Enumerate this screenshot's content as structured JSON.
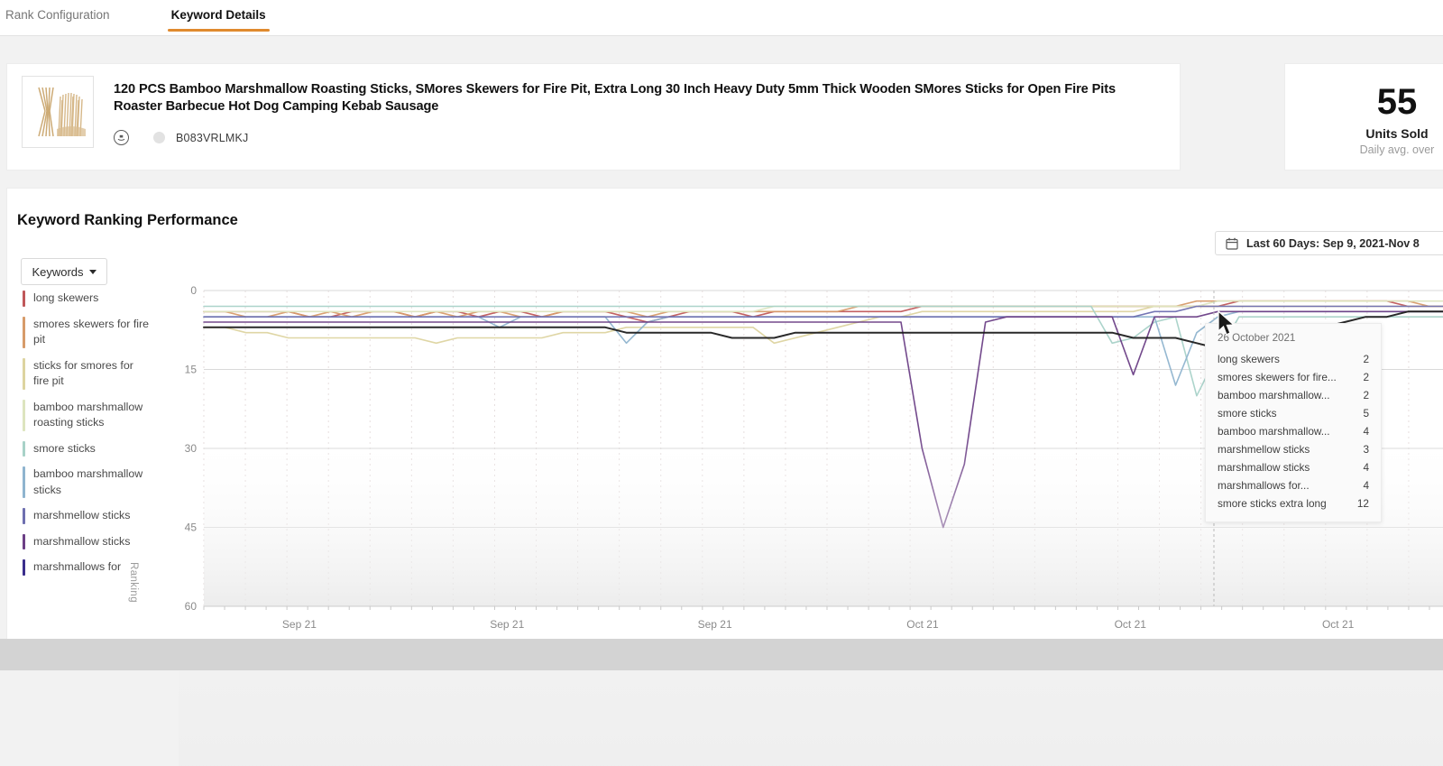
{
  "tabs": [
    {
      "label": "Rank Configuration",
      "active": false
    },
    {
      "label": "Keyword Details",
      "active": true
    }
  ],
  "product": {
    "title": "120 PCS Bamboo Marshmallow Roasting Sticks, SMores Skewers for Fire Pit, Extra Long 30 Inch Heavy Duty 5mm Thick Wooden SMores Sticks for Open Fire Pits Roaster Barbecue Hot Dog Camping Kebab Sausage",
    "asin": "B083VRLMKJ",
    "marketplace_icon": "amazon-badge-icon",
    "thumbnail_icon": "bamboo-skewers-thumbnail"
  },
  "stat_card": {
    "value": "55",
    "label": "Units Sold",
    "sublabel": "Daily avg. over"
  },
  "chart_panel": {
    "title": "Keyword Ranking Performance",
    "date_range": "Last 60 Days: Sep 9, 2021-Nov 8",
    "calendar_icon": "calendar-icon",
    "keywords_button": "Keywords",
    "axis_label_y": "Ranking"
  },
  "legend": [
    {
      "label": "long skewers",
      "color": "#c0585a"
    },
    {
      "label": "smores skewers for fire pit",
      "color": "#d79b6a"
    },
    {
      "label": "sticks for smores for fire pit",
      "color": "#ddd4a0"
    },
    {
      "label": "bamboo marshmallow roasting sticks",
      "color": "#dde5bf"
    },
    {
      "label": "smore sticks",
      "color": "#a8d2c8"
    },
    {
      "label": "bamboo marshmallow sticks",
      "color": "#8fb4cf"
    },
    {
      "label": "marshmellow sticks",
      "color": "#6e6fb0"
    },
    {
      "label": "marshmallow sticks",
      "color": "#6c3f86"
    },
    {
      "label": "marshmallows for",
      "color": "#3a2e8c"
    }
  ],
  "tooltip": {
    "date": "26 October 2021",
    "rows": [
      {
        "name": "long skewers",
        "value": "2"
      },
      {
        "name": "smores skewers for fire...",
        "value": "2"
      },
      {
        "name": "bamboo marshmallow...",
        "value": "2"
      },
      {
        "name": "smore sticks",
        "value": "5"
      },
      {
        "name": "bamboo marshmallow...",
        "value": "4"
      },
      {
        "name": "marshmellow sticks",
        "value": "3"
      },
      {
        "name": "marshmallow sticks",
        "value": "4"
      },
      {
        "name": "marshmallows for...",
        "value": "4"
      },
      {
        "name": "smore sticks extra long",
        "value": "12"
      }
    ]
  },
  "chart_data": {
    "type": "line",
    "title": "Keyword Ranking Performance",
    "xlabel": "",
    "ylabel": "Ranking",
    "ylim": [
      0,
      60
    ],
    "y_inverted": true,
    "yticks": [
      0,
      15,
      30,
      45,
      60
    ],
    "xticks": [
      "Sep 21",
      "Sep 21",
      "Sep 21",
      "Oct 21",
      "Oct 21",
      "Oct 21"
    ],
    "grid": true,
    "legend_position": "left",
    "x": [
      0,
      1,
      2,
      3,
      4,
      5,
      6,
      7,
      8,
      9,
      10,
      11,
      12,
      13,
      14,
      15,
      16,
      17,
      18,
      19,
      20,
      21,
      22,
      23,
      24,
      25,
      26,
      27,
      28,
      29,
      30,
      31,
      32,
      33,
      34,
      35,
      36,
      37,
      38,
      39,
      40,
      41,
      42,
      43,
      44,
      45,
      46,
      47,
      48,
      49,
      50,
      51,
      52,
      53,
      54,
      55,
      56,
      57,
      58,
      59
    ],
    "series": [
      {
        "name": "long skewers",
        "color": "#c0585a",
        "values": [
          4,
          4,
          4,
          4,
          4,
          5,
          5,
          4,
          4,
          4,
          5,
          4,
          4,
          5,
          4,
          4,
          5,
          4,
          4,
          4,
          5,
          6,
          5,
          4,
          4,
          4,
          5,
          4,
          4,
          4,
          4,
          4,
          4,
          4,
          3,
          3,
          3,
          3,
          3,
          3,
          3,
          3,
          3,
          3,
          3,
          3,
          3,
          3,
          3,
          2,
          2,
          2,
          2,
          2,
          2,
          2,
          2,
          3,
          3,
          3
        ]
      },
      {
        "name": "smores skewers for fire pit",
        "color": "#d79b6a",
        "values": [
          4,
          4,
          5,
          5,
          4,
          5,
          4,
          5,
          4,
          4,
          5,
          4,
          5,
          4,
          4,
          5,
          5,
          4,
          4,
          4,
          4,
          5,
          4,
          4,
          4,
          4,
          4,
          4,
          4,
          4,
          4,
          3,
          3,
          3,
          3,
          3,
          3,
          3,
          3,
          3,
          3,
          3,
          3,
          3,
          3,
          3,
          3,
          2,
          2,
          2,
          2,
          2,
          2,
          2,
          2,
          2,
          2,
          2,
          3,
          3
        ]
      },
      {
        "name": "sticks for smores for fire pit",
        "color": "#ddd4a0",
        "values": [
          7,
          7,
          8,
          8,
          9,
          9,
          9,
          9,
          9,
          9,
          9,
          10,
          9,
          9,
          9,
          9,
          9,
          8,
          8,
          8,
          7,
          7,
          7,
          7,
          7,
          7,
          7,
          10,
          9,
          8,
          7,
          6,
          5,
          5,
          4,
          4,
          4,
          4,
          4,
          4,
          4,
          4,
          4,
          4,
          4,
          3,
          3,
          3,
          3,
          3,
          3,
          3,
          3,
          3,
          3,
          3,
          3,
          3,
          3,
          3
        ]
      },
      {
        "name": "bamboo marshmallow roasting sticks",
        "color": "#dde5bf",
        "values": [
          4,
          4,
          4,
          4,
          4,
          4,
          4,
          4,
          4,
          4,
          4,
          4,
          4,
          4,
          4,
          4,
          4,
          4,
          4,
          4,
          4,
          4,
          4,
          4,
          4,
          4,
          4,
          3,
          3,
          3,
          3,
          3,
          3,
          3,
          3,
          3,
          3,
          3,
          3,
          3,
          3,
          3,
          3,
          3,
          3,
          3,
          3,
          3,
          2,
          2,
          2,
          2,
          2,
          2,
          2,
          2,
          2,
          2,
          2,
          2
        ]
      },
      {
        "name": "smore sticks",
        "color": "#a8d2c8",
        "values": [
          3,
          3,
          3,
          3,
          3,
          3,
          3,
          3,
          3,
          3,
          3,
          3,
          3,
          3,
          3,
          3,
          3,
          3,
          3,
          3,
          3,
          3,
          3,
          3,
          3,
          3,
          3,
          3,
          3,
          3,
          3,
          3,
          3,
          3,
          3,
          3,
          3,
          3,
          3,
          3,
          3,
          3,
          3,
          10,
          9,
          6,
          5,
          20,
          12,
          5,
          5,
          5,
          5,
          5,
          5,
          5,
          5,
          5,
          5,
          5
        ]
      },
      {
        "name": "bamboo marshmallow sticks",
        "color": "#8fb4cf",
        "values": [
          5,
          5,
          5,
          5,
          5,
          5,
          5,
          5,
          5,
          5,
          5,
          5,
          5,
          5,
          7,
          5,
          5,
          5,
          5,
          5,
          10,
          6,
          5,
          5,
          5,
          5,
          5,
          5,
          5,
          5,
          5,
          5,
          5,
          5,
          5,
          5,
          5,
          5,
          5,
          5,
          5,
          5,
          5,
          5,
          5,
          5,
          18,
          8,
          5,
          4,
          4,
          4,
          4,
          4,
          4,
          4,
          4,
          4,
          4,
          4
        ]
      },
      {
        "name": "marshmellow sticks",
        "color": "#6e6fb0",
        "values": [
          5,
          5,
          5,
          5,
          5,
          5,
          5,
          5,
          5,
          5,
          5,
          5,
          5,
          5,
          5,
          5,
          5,
          5,
          5,
          5,
          5,
          5,
          5,
          5,
          5,
          5,
          5,
          5,
          5,
          5,
          5,
          5,
          5,
          5,
          5,
          5,
          5,
          5,
          5,
          5,
          5,
          5,
          5,
          5,
          5,
          4,
          4,
          3,
          3,
          3,
          3,
          3,
          3,
          3,
          3,
          3,
          3,
          3,
          3,
          3
        ]
      },
      {
        "name": "marshmallow sticks",
        "color": "#6c3f86",
        "values": [
          6,
          6,
          6,
          6,
          6,
          6,
          6,
          6,
          6,
          6,
          6,
          6,
          6,
          6,
          6,
          6,
          6,
          6,
          6,
          6,
          6,
          6,
          6,
          6,
          6,
          6,
          6,
          6,
          6,
          6,
          6,
          6,
          6,
          6,
          30,
          45,
          33,
          6,
          5,
          5,
          5,
          5,
          5,
          5,
          16,
          5,
          5,
          5,
          4,
          4,
          4,
          4,
          4,
          4,
          4,
          4,
          4,
          4,
          4,
          4
        ]
      },
      {
        "name": "marshmallows for",
        "color": "#1e1e1e",
        "values": [
          7,
          7,
          7,
          7,
          7,
          7,
          7,
          7,
          7,
          7,
          7,
          7,
          7,
          7,
          7,
          7,
          7,
          7,
          7,
          7,
          8,
          8,
          8,
          8,
          8,
          9,
          9,
          9,
          8,
          8,
          8,
          8,
          8,
          8,
          8,
          8,
          8,
          8,
          8,
          8,
          8,
          8,
          8,
          8,
          9,
          9,
          9,
          10,
          11,
          10,
          9,
          9,
          8,
          7,
          6,
          5,
          5,
          4,
          4,
          4
        ]
      }
    ]
  }
}
